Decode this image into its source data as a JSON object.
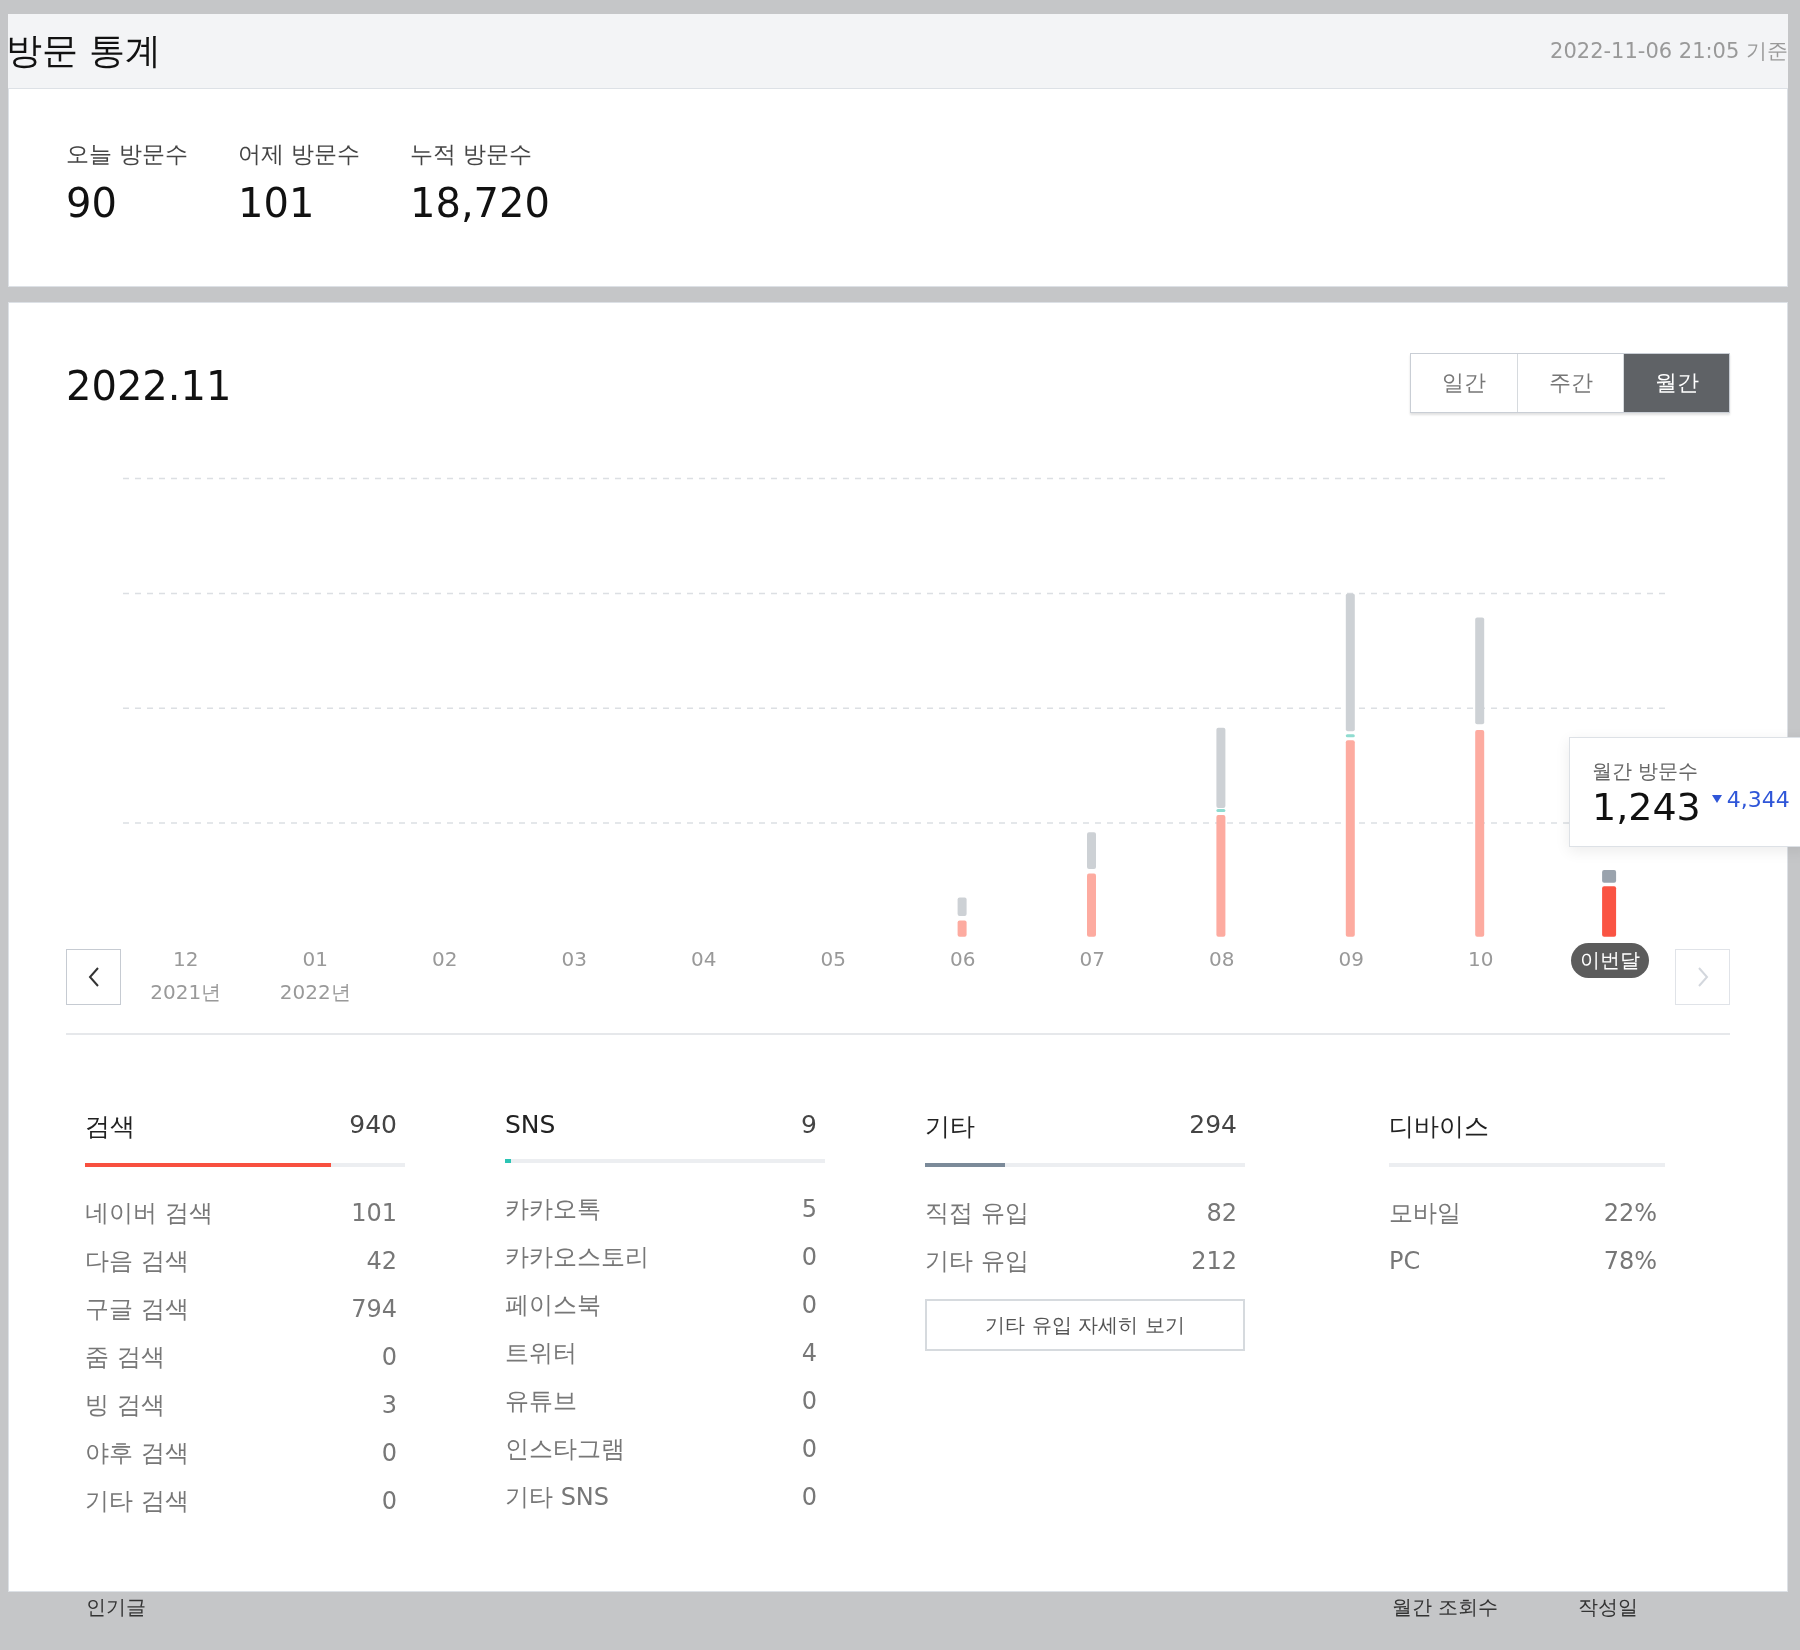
{
  "header": {
    "title": "방문 통계",
    "updated": "2022-11-06 21:05 기준"
  },
  "summary": [
    {
      "label": "오늘 방문수",
      "value": "90"
    },
    {
      "label": "어제 방문수",
      "value": "101"
    },
    {
      "label": "누적 방문수",
      "value": "18,720"
    }
  ],
  "period": {
    "title": "2022.11",
    "tabs": [
      {
        "label": "일간",
        "selected": false
      },
      {
        "label": "주간",
        "selected": false
      },
      {
        "label": "월간",
        "selected": true
      }
    ]
  },
  "chart": {
    "months": [
      {
        "label": "12",
        "year": "2021년",
        "current": false
      },
      {
        "label": "01",
        "year": "2022년",
        "current": false
      },
      {
        "label": "02",
        "current": false
      },
      {
        "label": "03",
        "current": false
      },
      {
        "label": "04",
        "current": false
      },
      {
        "label": "05",
        "current": false
      },
      {
        "label": "06",
        "current": false
      },
      {
        "label": "07",
        "current": false
      },
      {
        "label": "08",
        "current": false
      },
      {
        "label": "09",
        "current": false
      },
      {
        "label": "10",
        "current": false
      },
      {
        "label": "이번달",
        "current": true
      }
    ],
    "tooltip": {
      "title": "월간 방문수",
      "value": "1,243",
      "change": "4,344"
    }
  },
  "breakdown": [
    {
      "title": "검색",
      "total": "940",
      "level": 0.77,
      "color": "#f8503f",
      "rows": [
        {
          "label": "네이버 검색",
          "value": "101"
        },
        {
          "label": "다음 검색",
          "value": "42"
        },
        {
          "label": "구글 검색",
          "value": "794"
        },
        {
          "label": "줌 검색",
          "value": "0"
        },
        {
          "label": "빙 검색",
          "value": "3"
        },
        {
          "label": "야후 검색",
          "value": "0"
        },
        {
          "label": "기타 검색",
          "value": "0"
        }
      ]
    },
    {
      "title": "SNS",
      "total": "9",
      "level": 0.02,
      "color": "#2bc4b4",
      "rows": [
        {
          "label": "카카오톡",
          "value": "5"
        },
        {
          "label": "카카오스토리",
          "value": "0"
        },
        {
          "label": "페이스북",
          "value": "0"
        },
        {
          "label": "트위터",
          "value": "4"
        },
        {
          "label": "유튜브",
          "value": "0"
        },
        {
          "label": "인스타그램",
          "value": "0"
        },
        {
          "label": "기타 SNS",
          "value": "0"
        }
      ]
    },
    {
      "title": "기타",
      "total": "294",
      "level": 0.25,
      "color": "#7b8a99",
      "rows": [
        {
          "label": "직접 유입",
          "value": "82"
        },
        {
          "label": "기타 유입",
          "value": "212"
        }
      ],
      "button": "기타 유입 자세히 보기"
    },
    {
      "title": "디바이스",
      "rows": [
        {
          "label": "모바일",
          "value": "22%"
        },
        {
          "label": "PC",
          "value": "78%"
        }
      ]
    }
  ],
  "popular": {
    "columns": [
      "인기글",
      "월간 조회수",
      "작성일"
    ]
  }
}
